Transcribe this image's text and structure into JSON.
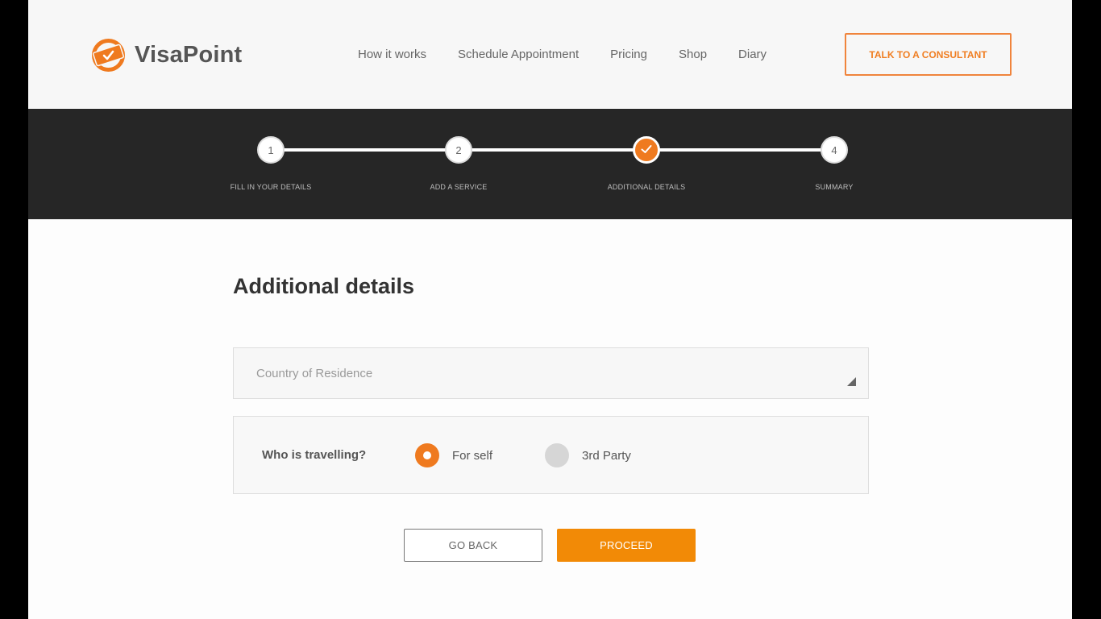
{
  "brand": {
    "name": "VisaPoint",
    "accent": "#ef7a1f",
    "logo_icon": "visa-ticket-logo-icon"
  },
  "nav": {
    "items": [
      "How it works",
      "Schedule Appointment",
      "Pricing",
      "Shop",
      "Diary"
    ],
    "cta": "TALK TO A CONSULTANT"
  },
  "stepper": {
    "steps": [
      {
        "number": "1",
        "label": "FILL IN YOUR DETAILS",
        "state": "pending"
      },
      {
        "number": "2",
        "label": "ADD A SERVICE",
        "state": "pending"
      },
      {
        "number": "",
        "label": "ADDITIONAL DETAILS",
        "state": "completed",
        "icon": "checkmark-icon"
      },
      {
        "number": "4",
        "label": "SUMMARY",
        "state": "pending"
      }
    ]
  },
  "form": {
    "title": "Additional details",
    "country": {
      "placeholder": "Country of Residence",
      "value": ""
    },
    "travelling": {
      "label": "Who is travelling?",
      "options": [
        {
          "label": "For self",
          "selected": true
        },
        {
          "label": "3rd Party",
          "selected": false
        }
      ]
    },
    "buttons": {
      "back": "GO BACK",
      "proceed": "PROCEED"
    }
  }
}
